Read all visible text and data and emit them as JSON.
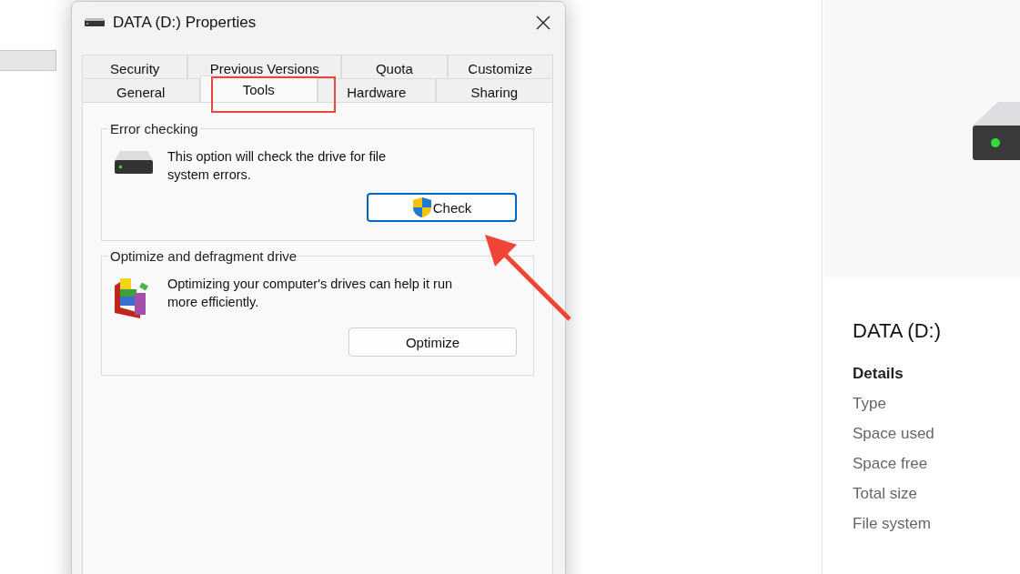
{
  "dialog": {
    "title": "DATA (D:) Properties",
    "tab_rows": [
      [
        {
          "label": "Security",
          "selected": false,
          "highlighted": false
        },
        {
          "label": "Previous Versions",
          "selected": false,
          "highlighted": false
        },
        {
          "label": "Quota",
          "selected": false,
          "highlighted": false
        },
        {
          "label": "Customize",
          "selected": false,
          "highlighted": false
        }
      ],
      [
        {
          "label": "General",
          "selected": false,
          "highlighted": false
        },
        {
          "label": "Tools",
          "selected": true,
          "highlighted": true
        },
        {
          "label": "Hardware",
          "selected": false,
          "highlighted": false
        },
        {
          "label": "Sharing",
          "selected": false,
          "highlighted": false
        }
      ]
    ],
    "groups": [
      {
        "kind": "drive",
        "title": "Error checking",
        "description": "This option will check the drive for file system errors.",
        "button": {
          "label": "Check",
          "elevated": true,
          "focused": true
        }
      },
      {
        "kind": "defrag",
        "title": "Optimize and defragment drive",
        "description": "Optimizing your computer's drives can help it run more efficiently.",
        "button": {
          "label": "Optimize",
          "elevated": false,
          "focused": false
        }
      }
    ]
  },
  "details_pane": {
    "title": "DATA (D:)",
    "heading": "Details",
    "labels": [
      "Type",
      "Space used",
      "Space free",
      "Total size",
      "File system"
    ]
  }
}
